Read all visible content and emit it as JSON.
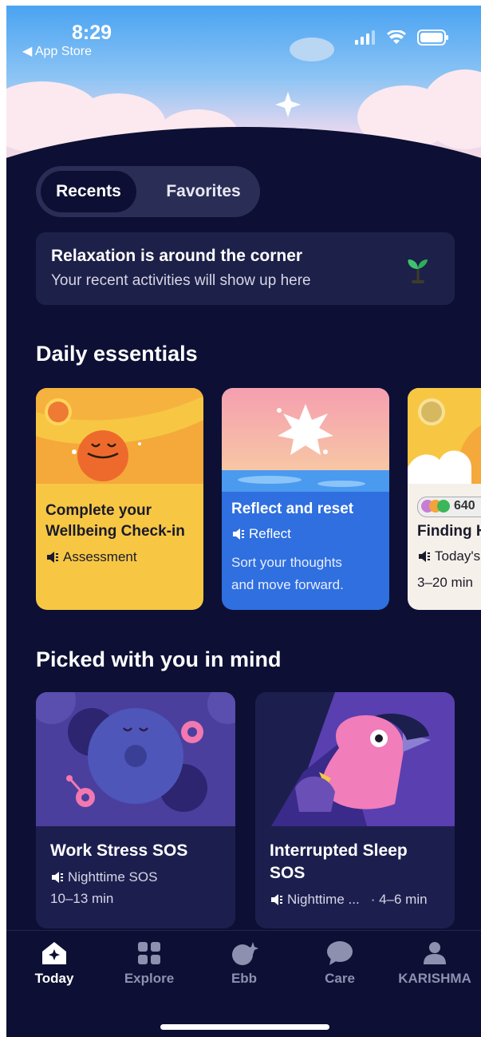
{
  "status": {
    "time": "8:29",
    "back_label": "◀ App Store"
  },
  "segmented": {
    "recents": "Recents",
    "favorites": "Favorites"
  },
  "empty_state": {
    "title": "Relaxation is around the corner",
    "subtitle": "Your recent activities will show up here",
    "icon": "sprout-icon"
  },
  "daily": {
    "title": "Daily essentials",
    "cards": [
      {
        "title_line1": "Complete your",
        "title_line2": "Wellbeing Check-in",
        "meta": "Assessment",
        "color": "#f7c744"
      },
      {
        "title": "Reflect and reset",
        "meta": "Reflect",
        "desc_line1": "Sort your thoughts",
        "desc_line2": "and move forward.",
        "color": "#2f6fe0"
      },
      {
        "badge": "640",
        "title": "Finding H",
        "meta": "Today's",
        "duration": "3–20 min",
        "color": "#f6f0ea"
      }
    ]
  },
  "picked": {
    "title": "Picked with you in mind",
    "cards": [
      {
        "title": "Work Stress SOS",
        "meta": "Nighttime SOS",
        "duration": "10–13 min"
      },
      {
        "title_line1": "Interrupted Sleep",
        "title_line2": "SOS",
        "meta": "Nighttime ...",
        "duration": "· 4–6 min"
      }
    ]
  },
  "tabs": [
    {
      "label": "Today",
      "icon": "home-icon",
      "active": true
    },
    {
      "label": "Explore",
      "icon": "grid-icon",
      "active": false
    },
    {
      "label": "Ebb",
      "icon": "ebb-icon",
      "active": false
    },
    {
      "label": "Care",
      "icon": "chat-bubble-icon",
      "active": false
    },
    {
      "label": "KARISHMA",
      "icon": "person-icon",
      "active": false
    }
  ]
}
